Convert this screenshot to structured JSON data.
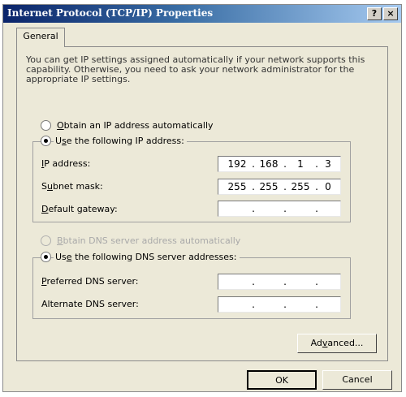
{
  "window": {
    "title": "Internet Protocol (TCP/IP) Properties",
    "help_button": "?",
    "close_button": "×"
  },
  "tabs": [
    {
      "label": "General"
    }
  ],
  "description": "You can get IP settings assigned automatically if your network supports this capability. Otherwise, you need to ask your network administrator for the appropriate IP settings.",
  "ip_options": {
    "auto": {
      "label": "Obtain an IP address automatically",
      "selected": false
    },
    "manual": {
      "label": "Use the following IP address:",
      "selected": true
    }
  },
  "ip_fields": [
    {
      "label": "IP address:",
      "octets": [
        "192",
        "168",
        "1",
        "3"
      ]
    },
    {
      "label": "Subnet mask:",
      "octets": [
        "255",
        "255",
        "255",
        "0"
      ]
    },
    {
      "label": "Default gateway:",
      "octets": [
        "",
        "",
        "",
        ""
      ]
    }
  ],
  "dns_options": {
    "auto": {
      "label": "Obtain DNS server address automatically",
      "selected": false,
      "enabled": false
    },
    "manual": {
      "label": "Use the following DNS server addresses:",
      "selected": true
    }
  },
  "dns_fields": [
    {
      "label": "Preferred DNS server:",
      "octets": [
        "",
        "",
        "",
        ""
      ]
    },
    {
      "label": "Alternate DNS server:",
      "octets": [
        "",
        "",
        "",
        ""
      ]
    }
  ],
  "buttons": {
    "advanced": "Advanced...",
    "ok": "OK",
    "cancel": "Cancel"
  }
}
